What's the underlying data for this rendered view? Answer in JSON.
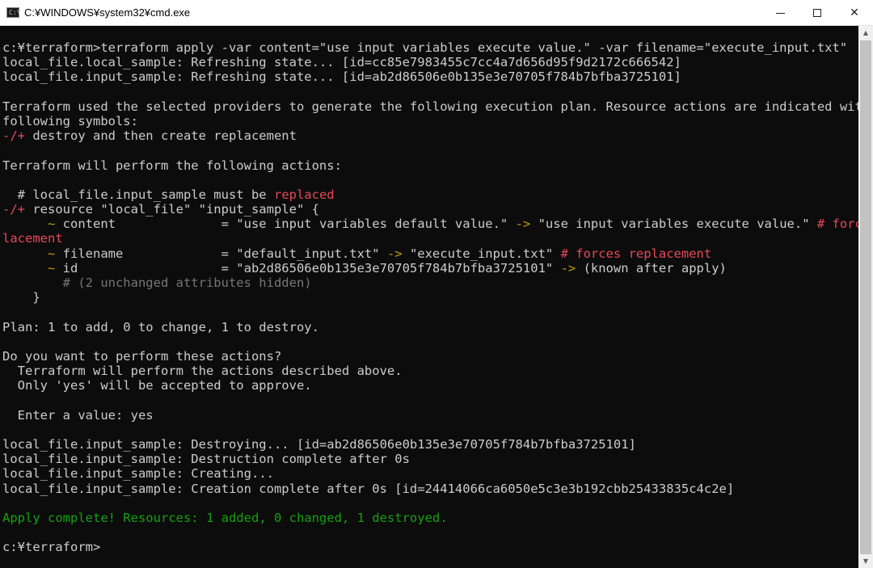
{
  "window": {
    "title": "C:¥WINDOWS¥system32¥cmd.exe",
    "icon_text": "C:\\",
    "controls": {
      "minimize": "minimize-icon",
      "maximize": "maximize-icon",
      "close": "close-icon"
    }
  },
  "colors": {
    "background": "#0c0c0c",
    "text": "#cccccc",
    "red": "#e74856",
    "yellow": "#c19c00",
    "green": "#13a10e",
    "gray": "#767676"
  },
  "console": {
    "l1": "c:¥terraform>terraform apply -var content=\"use input variables execute value.\" -var filename=\"execute_input.txt\"",
    "l2": "local_file.local_sample: Refreshing state... [id=cc85e7983455c7cc4a7d656d95f9d2172c666542]",
    "l3": "local_file.input_sample: Refreshing state... [id=ab2d86506e0b135e3e70705f784b7bfba3725101]",
    "l4": "",
    "l5": "Terraform used the selected providers to generate the following execution plan. Resource actions are indicated with the",
    "l6": "following symbols:",
    "l7_sym": "-/+",
    "l7_text": " destroy and then create replacement",
    "l8": "",
    "l9": "Terraform will perform the following actions:",
    "l10": "",
    "l11_a": "  # local_file.input_sample must be ",
    "l11_b": "replaced",
    "l12_sym": "-/+",
    "l12_text": " resource \"local_file\" \"input_sample\" {",
    "l13_tilde": "      ~",
    "l13_a": " content              = \"use input variables default value.\" ",
    "l13_arrow": "->",
    "l13_b": " \"use input variables execute value.\" ",
    "l13_c": "# forces rep",
    "l14": "lacement",
    "l15_tilde": "      ~",
    "l15_a": " filename             = \"default_input.txt\" ",
    "l15_arrow": "->",
    "l15_b": " \"execute_input.txt\" ",
    "l15_c": "# forces replacement",
    "l16_tilde": "      ~",
    "l16_a": " id                   = \"ab2d86506e0b135e3e70705f784b7bfba3725101\" ",
    "l16_arrow": "->",
    "l16_b": " (known after apply)",
    "l17": "        # (2 unchanged attributes hidden)",
    "l18": "    }",
    "l19": "",
    "l20": "Plan: 1 to add, 0 to change, 1 to destroy.",
    "l21": "",
    "l22": "Do you want to perform these actions?",
    "l23": "  Terraform will perform the actions described above.",
    "l24": "  Only 'yes' will be accepted to approve.",
    "l25": "",
    "l26": "  Enter a value: yes",
    "l27": "",
    "l28": "local_file.input_sample: Destroying... [id=ab2d86506e0b135e3e70705f784b7bfba3725101]",
    "l29": "local_file.input_sample: Destruction complete after 0s",
    "l30": "local_file.input_sample: Creating...",
    "l31": "local_file.input_sample: Creation complete after 0s [id=24414066ca6050e5c3e3b192cbb25433835c4c2e]",
    "l32": "",
    "l33": "Apply complete! Resources: 1 added, 0 changed, 1 destroyed.",
    "l34": "",
    "l35": "c:¥terraform>"
  }
}
